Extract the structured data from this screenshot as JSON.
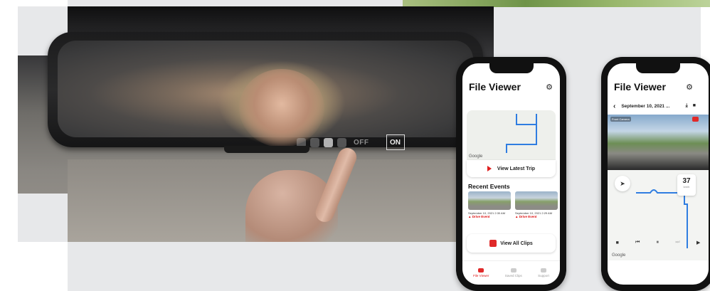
{
  "mirror_display": {
    "off_label": "OFF",
    "on_label": "ON"
  },
  "phone_left": {
    "title": "File Viewer",
    "settings_icon": "gear-icon",
    "map_attribution": "Google",
    "view_trip_label": "View Latest Trip",
    "recent_events_title": "Recent Events",
    "clips": [
      {
        "date": "September 10, 2021 2:30 AM",
        "event": "Drive Event"
      },
      {
        "date": "September 10, 2021 2:29 AM",
        "event": "Drive Event"
      }
    ],
    "view_all_label": "View All Clips",
    "tabs": [
      {
        "label": "File Viewer",
        "active": true
      },
      {
        "label": "Saved Clips",
        "active": false
      },
      {
        "label": "Support",
        "active": false
      }
    ],
    "accent": "#e02a2a"
  },
  "phone_right": {
    "title": "File Viewer",
    "settings_icon": "gear-icon",
    "date_label": "September 10, 2021 ...",
    "camera_tag": "Front Camera",
    "speed_value": "37",
    "speed_unit": "km/h",
    "map_attribution": "Google"
  }
}
